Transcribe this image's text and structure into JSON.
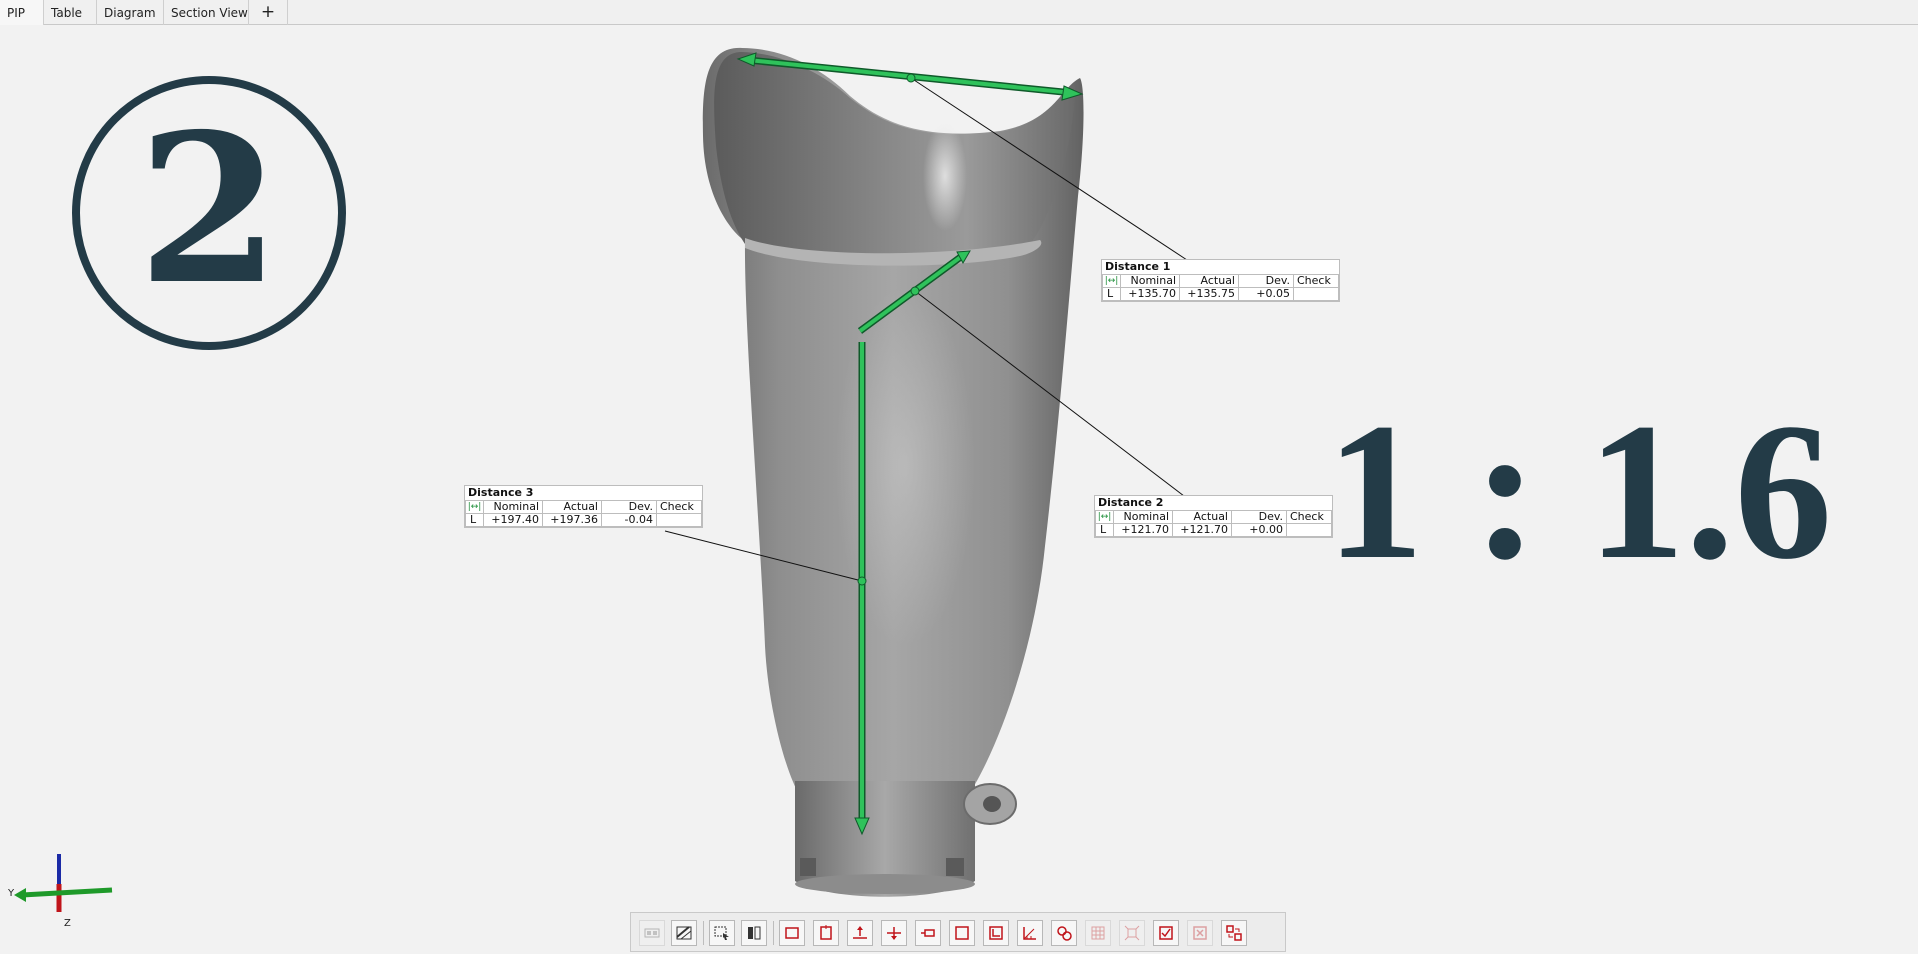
{
  "tabs": [
    {
      "label": "PIP",
      "active": true
    },
    {
      "label": "Table",
      "active": false
    },
    {
      "label": "Diagram",
      "active": false
    },
    {
      "label": "Section View",
      "active": false
    }
  ],
  "add_tab_label": "+",
  "step_badge": "2",
  "scale_label": "1 : 1.6",
  "measurements": [
    {
      "title": "Distance 1",
      "headers": [
        "Nominal",
        "Actual",
        "Dev.",
        "Check"
      ],
      "row_label": "L",
      "nominal": "+135.70",
      "actual": "+135.75",
      "deviation": "+0.05",
      "check": ""
    },
    {
      "title": "Distance 2",
      "headers": [
        "Nominal",
        "Actual",
        "Dev.",
        "Check"
      ],
      "row_label": "L",
      "nominal": "+121.70",
      "actual": "+121.70",
      "deviation": "+0.00",
      "check": ""
    },
    {
      "title": "Distance 3",
      "headers": [
        "Nominal",
        "Actual",
        "Dev.",
        "Check"
      ],
      "row_label": "L",
      "nominal": "+197.40",
      "actual": "+197.36",
      "deviation": "-0.04",
      "check": ""
    }
  ],
  "axis_labels": {
    "y": "Y",
    "z": "Z"
  },
  "colors": {
    "label_dark": "#233b47",
    "measure_green": "#22a04b",
    "axis_red": "#c0141a",
    "axis_blue": "#1b2aa6",
    "icon_red": "#c0141a"
  },
  "toolbar_icons": [
    {
      "name": "view-legend-icon",
      "disabled": true
    },
    {
      "name": "hatch-toggle-icon",
      "disabled": false
    },
    {
      "name": "select-region-icon",
      "disabled": false
    },
    {
      "name": "split-view-icon",
      "disabled": false
    },
    {
      "name": "frame-box-icon",
      "disabled": false
    },
    {
      "name": "frame-vertical-icon",
      "disabled": false
    },
    {
      "name": "align-up-icon",
      "disabled": false
    },
    {
      "name": "align-cross-icon",
      "disabled": false
    },
    {
      "name": "move-element-icon",
      "disabled": false
    },
    {
      "name": "square-frame-icon",
      "disabled": false
    },
    {
      "name": "corner-frame-icon",
      "disabled": false
    },
    {
      "name": "ruler-angle-icon",
      "disabled": false
    },
    {
      "name": "link-elements-icon",
      "disabled": false
    },
    {
      "name": "grid-select-icon",
      "disabled": true
    },
    {
      "name": "fit-view-icon",
      "disabled": true
    },
    {
      "name": "check-report-icon",
      "disabled": false
    },
    {
      "name": "remove-check-icon",
      "disabled": true
    },
    {
      "name": "convert-element-icon",
      "disabled": false
    }
  ]
}
